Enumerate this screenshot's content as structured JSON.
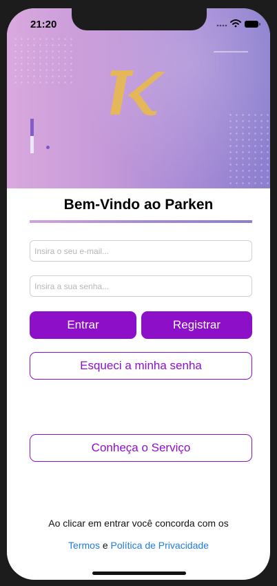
{
  "status_bar": {
    "time": "21:20",
    "icons": [
      "signal-icon",
      "wifi-icon",
      "battery-icon"
    ]
  },
  "hero": {
    "logo_icon": "parken-k-logo-icon",
    "colors": {
      "gradient_start": "#d9a9de",
      "gradient_end": "#8b7fcf",
      "logo": "#e3b75a"
    }
  },
  "login": {
    "title": "Bem-Vindo ao Parken",
    "email_placeholder": "Insira o seu e-mail...",
    "email_value": "",
    "password_placeholder": "Insira a sua senha...",
    "password_value": "",
    "enter_label": "Entrar",
    "register_label": "Registrar",
    "forgot_label": "Esqueci a minha senha",
    "service_label": "Conheça o Serviço"
  },
  "footer": {
    "agreement_text": "Ao clicar em entrar você concorda com os",
    "terms_label": "Termos",
    "conjunction": "e",
    "privacy_label": "Política de Privacidade"
  },
  "colors": {
    "accent": "#8d0fc8",
    "link": "#1e7be0"
  }
}
